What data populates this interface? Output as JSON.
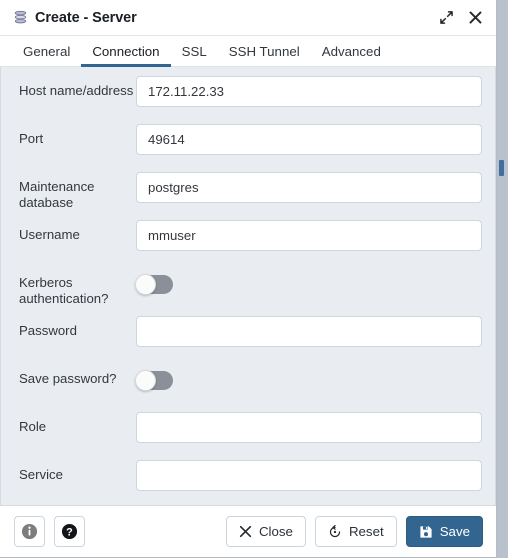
{
  "window": {
    "title": "Create - Server",
    "icon": "server-stack-icon",
    "expand_icon": "expand-diagonal-icon",
    "close_icon": "close-x-icon"
  },
  "tabs": [
    {
      "label": "General",
      "active": false
    },
    {
      "label": "Connection",
      "active": true
    },
    {
      "label": "SSL",
      "active": false
    },
    {
      "label": "SSH Tunnel",
      "active": false
    },
    {
      "label": "Advanced",
      "active": false
    }
  ],
  "fields": [
    {
      "name": "host",
      "label": "Host name/address",
      "type": "text",
      "value": "172.11.22.33",
      "placeholder": ""
    },
    {
      "name": "port",
      "label": "Port",
      "type": "text",
      "value": "49614",
      "placeholder": ""
    },
    {
      "name": "maintenance-database",
      "label": "Maintenance database",
      "type": "text",
      "value": "postgres",
      "placeholder": ""
    },
    {
      "name": "username",
      "label": "Username",
      "type": "text",
      "value": "mmuser",
      "placeholder": ""
    },
    {
      "name": "kerberos-authentication",
      "label": "Kerberos authentication?",
      "type": "toggle",
      "value": "off"
    },
    {
      "name": "password",
      "label": "Password",
      "type": "password",
      "value": "",
      "placeholder": ""
    },
    {
      "name": "save-password",
      "label": "Save password?",
      "type": "toggle",
      "value": "off"
    },
    {
      "name": "role",
      "label": "Role",
      "type": "text",
      "value": "",
      "placeholder": ""
    },
    {
      "name": "service",
      "label": "Service",
      "type": "text",
      "value": "",
      "placeholder": ""
    }
  ],
  "footer": {
    "info_icon": "info-circle-icon",
    "help_icon": "help-question-icon",
    "close_label": "Close",
    "close_icon": "close-x-icon",
    "reset_label": "Reset",
    "reset_icon": "reset-rotate-icon",
    "save_label": "Save",
    "save_icon": "save-floppy-icon"
  },
  "colors": {
    "accent": "#326690",
    "form_background": "#e9edf2",
    "panel_background": "#ffffff",
    "toggle_off": "#8b9098",
    "text": "#33383d"
  }
}
